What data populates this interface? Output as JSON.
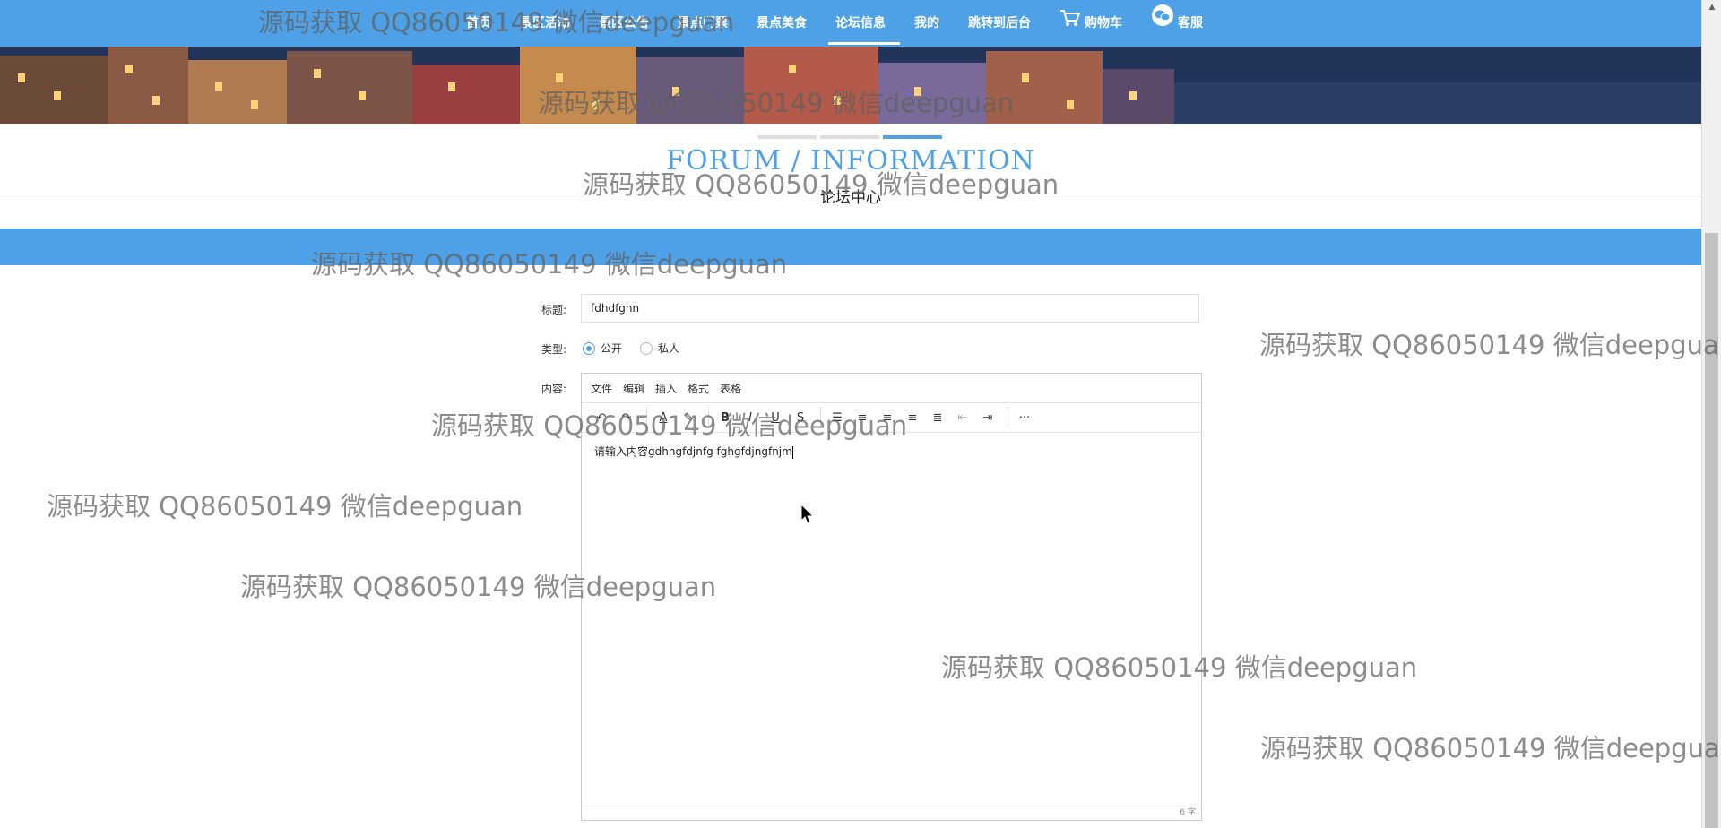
{
  "nav": {
    "items": [
      {
        "label": "首页",
        "active": false
      },
      {
        "label": "景区活动",
        "active": false
      },
      {
        "label": "景区公告",
        "active": false
      },
      {
        "label": "景点门票",
        "active": false
      },
      {
        "label": "景点美食",
        "active": false
      },
      {
        "label": "论坛信息",
        "active": true
      },
      {
        "label": "我的",
        "active": false
      },
      {
        "label": "跳转到后台",
        "active": false
      }
    ],
    "cart_label": "购物车",
    "service_label": "客服"
  },
  "section": {
    "title": "FORUM / INFORMATION",
    "subtitle": "论坛中心"
  },
  "form": {
    "title_label": "标题:",
    "title_value": "fdhdfghn",
    "type_label": "类型:",
    "type_options": [
      {
        "label": "公开",
        "checked": true
      },
      {
        "label": "私人",
        "checked": false
      }
    ],
    "content_label": "内容:"
  },
  "editor": {
    "menus": [
      "文件",
      "编辑",
      "插入",
      "格式",
      "表格"
    ],
    "content": "请输入内容gdhngfdjnfg fghgfdjngfnjm",
    "word_count": "6 字"
  },
  "watermark_text": "源码获取 QQ86050149 微信deepguan",
  "colors": {
    "accent": "#4ea1e6"
  }
}
